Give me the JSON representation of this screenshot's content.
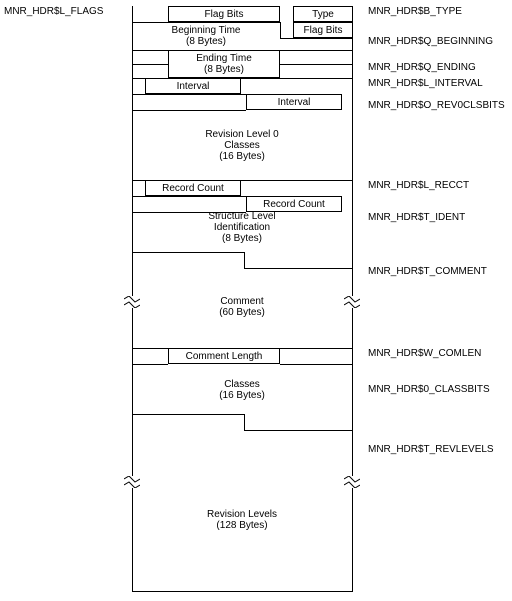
{
  "left": {
    "flags": "MNR_HDR$L_FLAGS"
  },
  "right": {
    "type": "MNR_HDR$B_TYPE",
    "beginning": "MNR_HDR$Q_BEGINNING",
    "ending": "MNR_HDR$Q_ENDING",
    "interval": "MNR_HDR$L_INTERVAL",
    "rev0": "MNR_HDR$O_REV0CLSBITS",
    "recct": "MNR_HDR$L_RECCT",
    "ident": "MNR_HDR$T_IDENT",
    "comment": "MNR_HDR$T_COMMENT",
    "comlen": "MNR_HDR$W_COMLEN",
    "classbits": "MNR_HDR$0_CLASSBITS",
    "revlevels": "MNR_HDR$T_REVLEVELS"
  },
  "cells": {
    "flag_bits1": "Flag Bits",
    "type": "Type",
    "beginning_a": "Beginning Time",
    "beginning_b": "(8 Bytes)",
    "flag_bits2": "Flag Bits",
    "ending_a": "Ending Time",
    "ending_b": "(8 Bytes)",
    "interval1": "Interval",
    "interval2": "Interval",
    "rev0_a": "Revision Level 0",
    "rev0_b": "Classes",
    "rev0_c": "(16 Bytes)",
    "recct1": "Record Count",
    "recct2": "Record Count",
    "ident_a": "Structure Level",
    "ident_b": "Identification",
    "ident_c": "(8 Bytes)",
    "comment_a": "Comment",
    "comment_b": "(60 Bytes)",
    "comlen": "Comment Length",
    "classes_a": "Classes",
    "classes_b": "(16 Bytes)",
    "revlevels_a": "Revision Levels",
    "revlevels_b": "(128 Bytes)"
  }
}
